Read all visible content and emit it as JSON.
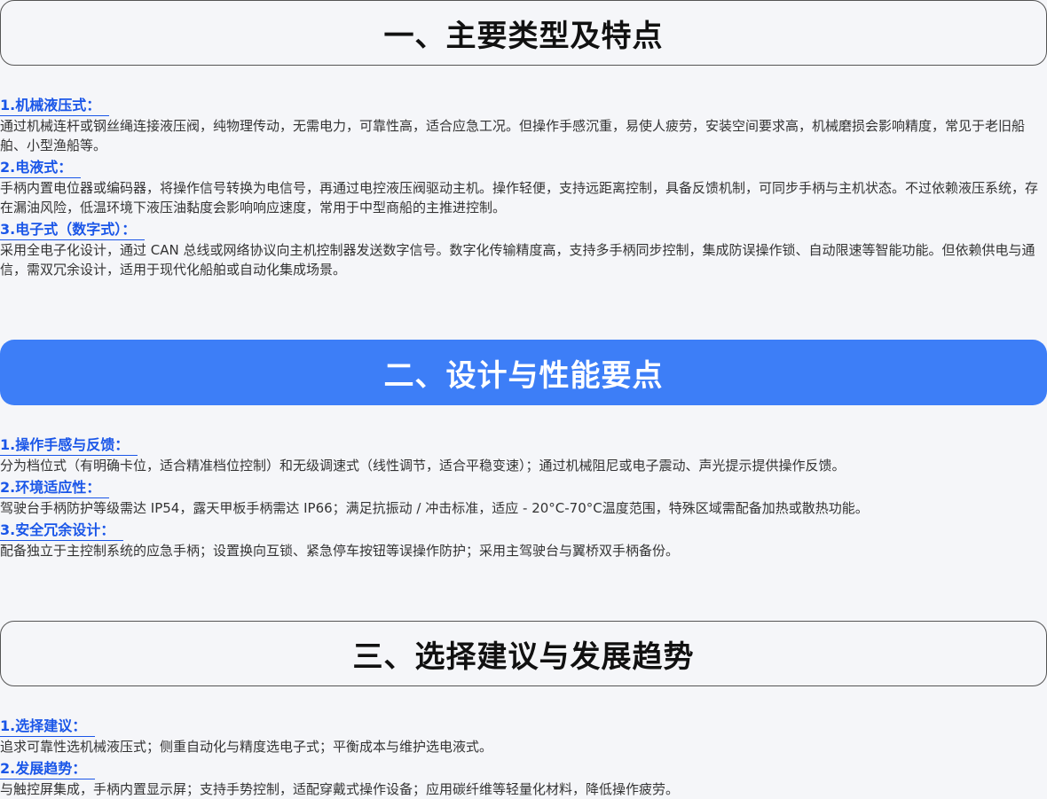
{
  "sections": [
    {
      "title": "一、主要类型及特点",
      "items": [
        {
          "label": "1.机械液压式：",
          "text": "通过机械连杆或钢丝绳连接液压阀，纯物理传动，无需电力，可靠性高，适合应急工况。但操作手感沉重，易使人疲劳，安装空间要求高，机械磨损会影响精度，常见于老旧船舶、小型渔船等。"
        },
        {
          "label": "2.电液式：",
          "text": "手柄内置电位器或编码器，将操作信号转换为电信号，再通过电控液压阀驱动主机。操作轻便，支持远距离控制，具备反馈机制，可同步手柄与主机状态。不过依赖液压系统，存在漏油风险，低温环境下液压油黏度会影响响应速度，常用于中型商船的主推进控制。"
        },
        {
          "label": "3.电子式（数字式）：",
          "text": "采用全电子化设计，通过 CAN 总线或网络协议向主机控制器发送数字信号。数字化传输精度高，支持多手柄同步控制，集成防误操作锁、自动限速等智能功能。但依赖供电与通信，需双冗余设计，适用于现代化船舶或自动化集成场景。"
        }
      ]
    },
    {
      "title": "二、设计与性能要点",
      "items": [
        {
          "label": "1.操作手感与反馈：",
          "text": "分为档位式（有明确卡位，适合精准档位控制）和无级调速式（线性调节，适合平稳变速）；通过机械阻尼或电子震动、声光提示提供操作反馈。"
        },
        {
          "label": "2.环境适应性：",
          "text": "驾驶台手柄防护等级需达 IP54，露天甲板手柄需达 IP66；满足抗振动 / 冲击标准，适应 - 20°C-70°C温度范围，特殊区域需配备加热或散热功能。"
        },
        {
          "label": "3.安全冗余设计：",
          "text": "配备独立于主控制系统的应急手柄；设置换向互锁、紧急停车按钮等误操作防护；采用主驾驶台与翼桥双手柄备份。"
        }
      ]
    },
    {
      "title": "三、选择建议与发展趋势",
      "items": [
        {
          "label": "1.选择建议：",
          "text": "追求可靠性选机械液压式；侧重自动化与精度选电子式；平衡成本与维护选电液式。"
        },
        {
          "label": "2.发展趋势：",
          "text": "与触控屏集成，手柄内置显示屏；支持手势控制，适配穿戴式操作设备；应用碳纤维等轻量化材料，降低操作疲劳。"
        }
      ]
    }
  ],
  "colors": {
    "accent": "#3d7ef7",
    "link": "#1a56e8",
    "background": "#f5f6f9"
  }
}
